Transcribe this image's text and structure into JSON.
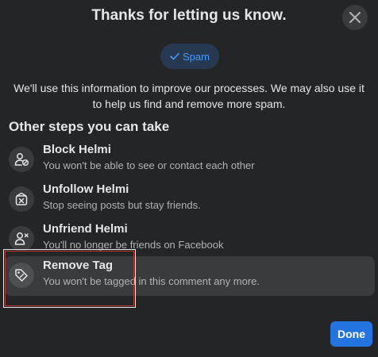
{
  "dialog": {
    "title": "Thanks for letting us know.",
    "close_icon": "close-icon"
  },
  "report_tag": {
    "icon": "checkmark-icon",
    "label": "Spam"
  },
  "info_text": "We'll use this information to improve our processes. We may also use it to help us find and remove more spam.",
  "section_title": "Other steps you can take",
  "options": [
    {
      "title": "Block Helmi",
      "subtitle": "You won't be able to see or contact each other",
      "icon": "block-user-icon",
      "highlighted": false
    },
    {
      "title": "Unfollow Helmi",
      "subtitle": "Stop seeing posts but stay friends.",
      "icon": "unfollow-icon",
      "highlighted": false
    },
    {
      "title": "Unfriend Helmi",
      "subtitle": "You'll no longer be friends on Facebook",
      "icon": "unfriend-icon",
      "highlighted": false
    },
    {
      "title": "Remove Tag",
      "subtitle": "You won't be tagged in this comment any more.",
      "icon": "remove-tag-icon",
      "highlighted": true
    }
  ],
  "done_label": "Done",
  "colors": {
    "background": "#242526",
    "accent": "#2374e1",
    "pill_background": "#263951",
    "pill_text": "#4599ff",
    "highlight_row": "#3a3b3c",
    "annotation_box": "#c0392b"
  }
}
